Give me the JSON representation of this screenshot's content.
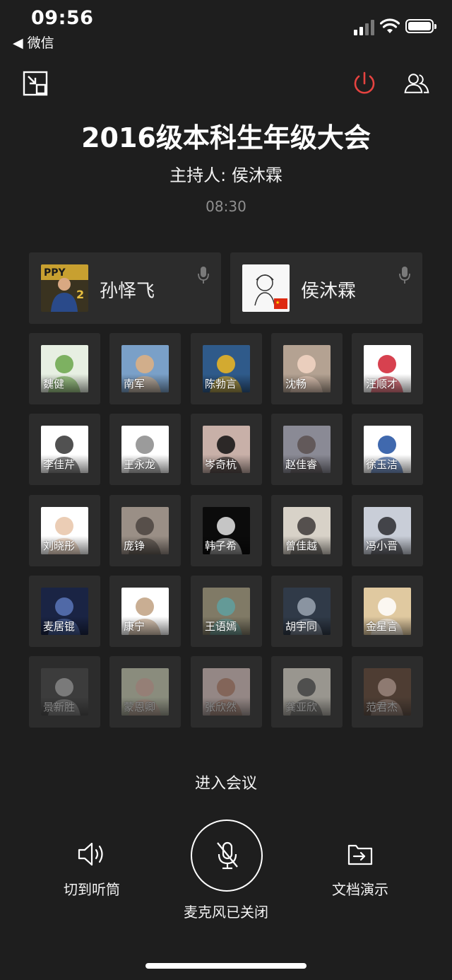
{
  "status_bar": {
    "time": "09:56",
    "back_app": "◀ 微信"
  },
  "toolbar": {
    "minimize_icon": "minimize-window-icon",
    "end_call_icon": "power-icon",
    "members_icon": "members-icon",
    "end_color": "#e64340"
  },
  "meeting": {
    "title": "2016级本科生年级大会",
    "host": "主持人: 侯沐霖",
    "elapsed": "08:30"
  },
  "hosts": [
    {
      "name": "孙怿飞"
    },
    {
      "name": "侯沐霖"
    }
  ],
  "participants": [
    {
      "name": "魏健"
    },
    {
      "name": "南军"
    },
    {
      "name": "陈勃言"
    },
    {
      "name": "沈畅"
    },
    {
      "name": "汪顺才"
    },
    {
      "name": "李佳芹"
    },
    {
      "name": "王永龙"
    },
    {
      "name": "岑奇杭"
    },
    {
      "name": "赵佳睿"
    },
    {
      "name": "徐玉洁"
    },
    {
      "name": "刘晓彤"
    },
    {
      "name": "庞铮"
    },
    {
      "name": "韩子希"
    },
    {
      "name": "曾佳越"
    },
    {
      "name": "冯小晋"
    },
    {
      "name": "麦居锟"
    },
    {
      "name": "康宁"
    },
    {
      "name": "王语嫣"
    },
    {
      "name": "胡宇同"
    },
    {
      "name": "金星言"
    },
    {
      "name": "景新胜"
    },
    {
      "name": "蒙恩卿"
    },
    {
      "name": "张欣然"
    },
    {
      "name": "龚亚欣"
    },
    {
      "name": "范君杰"
    }
  ],
  "bottom": {
    "enter_meeting": "进入会议",
    "speaker_label": "切到听筒",
    "mic_label": "麦克风已关闭",
    "share_label": "文档演示"
  }
}
